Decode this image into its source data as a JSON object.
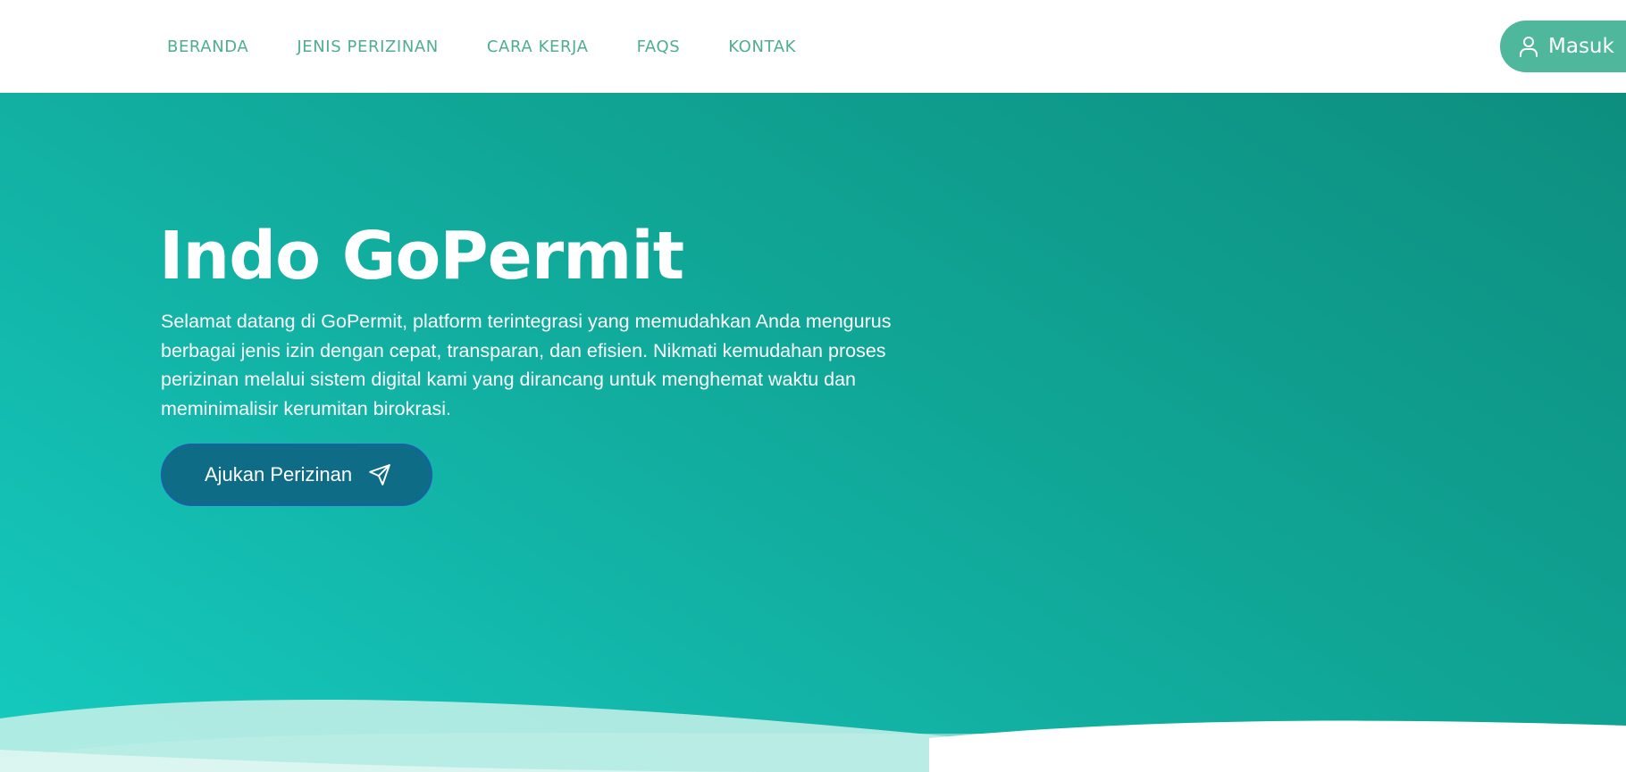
{
  "nav": {
    "items": [
      {
        "label": "BERANDA"
      },
      {
        "label": "JENIS PERIZINAN"
      },
      {
        "label": "CARA KERJA"
      },
      {
        "label": "FAQS"
      },
      {
        "label": "KONTAK"
      }
    ],
    "login": {
      "label": "Masuk",
      "icon": "user-icon"
    }
  },
  "hero": {
    "title": "Indo GoPermit",
    "description": "Selamat datang di GoPermit, platform terintegrasi yang memudahkan Anda mengurus berbagai jenis izin dengan cepat, transparan, dan efisien. Nikmati kemudahan proses perizinan melalui sistem digital kami yang dirancang untuk menghemat waktu dan meminimalisir kerumitan birokrasi.",
    "cta": {
      "label": "Ajukan Perizinan",
      "icon": "send-icon"
    }
  },
  "colors": {
    "nav_text": "#4fae8f",
    "login_bg": "#4fb79b",
    "hero_start": "#15cbbf",
    "hero_end": "#0d8e7f",
    "cta_bg": "#0f6c86"
  }
}
